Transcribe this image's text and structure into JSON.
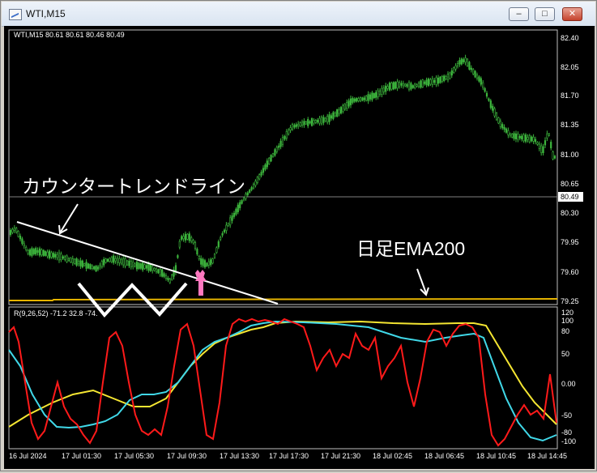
{
  "window": {
    "title": "WTI,M15",
    "min_glyph": "–",
    "max_glyph": "□",
    "close_glyph": "✕"
  },
  "main_chart": {
    "header": "WTI,M15  80.61 80.61 80.46 80.49",
    "current_price": "80.49",
    "price_ticks": [
      "82.40",
      "82.05",
      "81.70",
      "81.35",
      "81.00",
      "80.65",
      "80.30",
      "79.95",
      "79.60",
      "79.25"
    ],
    "candle_color": "#3cb43c",
    "ema_color": "#e6b400",
    "annotations": {
      "counter_trendline": "カウンタートレンドライン",
      "daily_ema": "日足EMA200"
    }
  },
  "indicator": {
    "header": "R(9,26,52) -71.2 32.8 -74.",
    "ticks": [
      "120",
      "100",
      "80",
      "50",
      "0.00",
      "-50",
      "-80",
      "-100"
    ],
    "colors": {
      "red": "#ff1a1a",
      "cyan": "#40d8e8",
      "yellow": "#f5e632"
    }
  },
  "time_axis": {
    "labels": [
      "16 Jul 2024",
      "17 Jul 01:30",
      "17 Jul 05:30",
      "17 Jul 09:30",
      "17 Jul 13:30",
      "17 Jul 17:30",
      "17 Jul 21:30",
      "18 Jul 02:45",
      "18 Jul 06:45",
      "18 Jul 10:45",
      "18 Jul 14:45"
    ]
  }
}
